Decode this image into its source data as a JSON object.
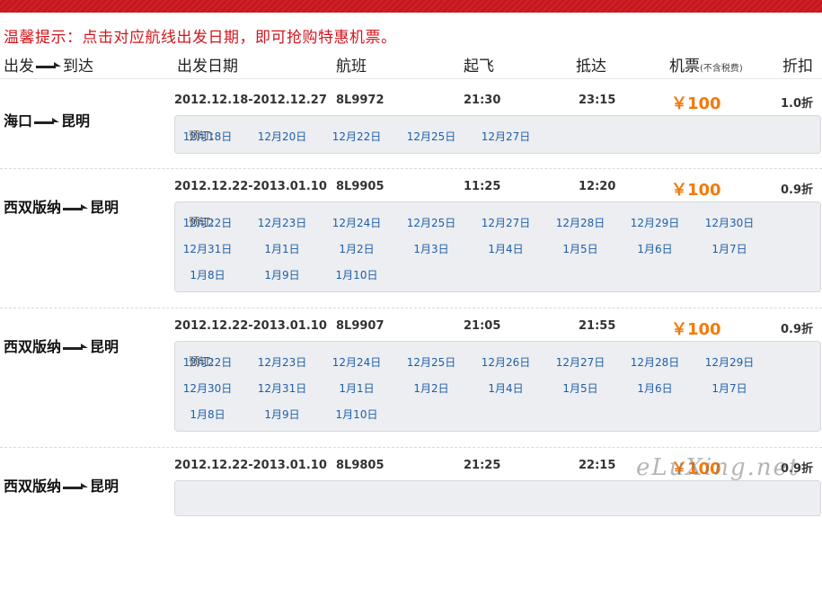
{
  "notice": "温馨提示：点击对应航线出发日期，即可抢购特惠机票。",
  "columns": {
    "route_from": "出发",
    "route_to": "到达",
    "date": "出发日期",
    "flight_no": "航班",
    "depart": "起飞",
    "arrive": "抵达",
    "price": "机票",
    "price_note": "(不含税费)",
    "discount": "折扣"
  },
  "book_label": "预订:",
  "price_symbol": "￥",
  "watermark": "eLuXing.net",
  "colors": {
    "accent_red": "#d2161e",
    "price_orange": "#f47a0a",
    "link_blue": "#1f5ea8"
  },
  "flights": [
    {
      "from": "海口",
      "to": "昆明",
      "period": "2012.12.18-2012.12.27",
      "flight_no": "8L9972",
      "depart": "21:30",
      "arrive": "23:15",
      "price": "100",
      "discount": "1.0折",
      "dates": [
        "12月18日",
        "12月20日",
        "12月22日",
        "12月25日",
        "12月27日"
      ]
    },
    {
      "from": "西双版纳",
      "to": "昆明",
      "period": "2012.12.22-2013.01.10",
      "flight_no": "8L9905",
      "depart": "11:25",
      "arrive": "12:20",
      "price": "100",
      "discount": "0.9折",
      "dates": [
        "12月22日",
        "12月23日",
        "12月24日",
        "12月25日",
        "12月27日",
        "12月28日",
        "12月29日",
        "12月30日",
        "12月31日",
        "1月1日",
        "1月2日",
        "1月3日",
        "1月4日",
        "1月5日",
        "1月6日",
        "1月7日",
        "1月8日",
        "1月9日",
        "1月10日"
      ]
    },
    {
      "from": "西双版纳",
      "to": "昆明",
      "period": "2012.12.22-2013.01.10",
      "flight_no": "8L9907",
      "depart": "21:05",
      "arrive": "21:55",
      "price": "100",
      "discount": "0.9折",
      "dates": [
        "12月22日",
        "12月23日",
        "12月24日",
        "12月25日",
        "12月26日",
        "12月27日",
        "12月28日",
        "12月29日",
        "12月30日",
        "12月31日",
        "1月1日",
        "1月2日",
        "1月4日",
        "1月5日",
        "1月6日",
        "1月7日",
        "1月8日",
        "1月9日",
        "1月10日"
      ]
    },
    {
      "from": "西双版纳",
      "to": "昆明",
      "period": "2012.12.22-2013.01.10",
      "flight_no": "8L9805",
      "depart": "21:25",
      "arrive": "22:15",
      "price": "100",
      "discount": "0.9折",
      "dates": []
    }
  ]
}
